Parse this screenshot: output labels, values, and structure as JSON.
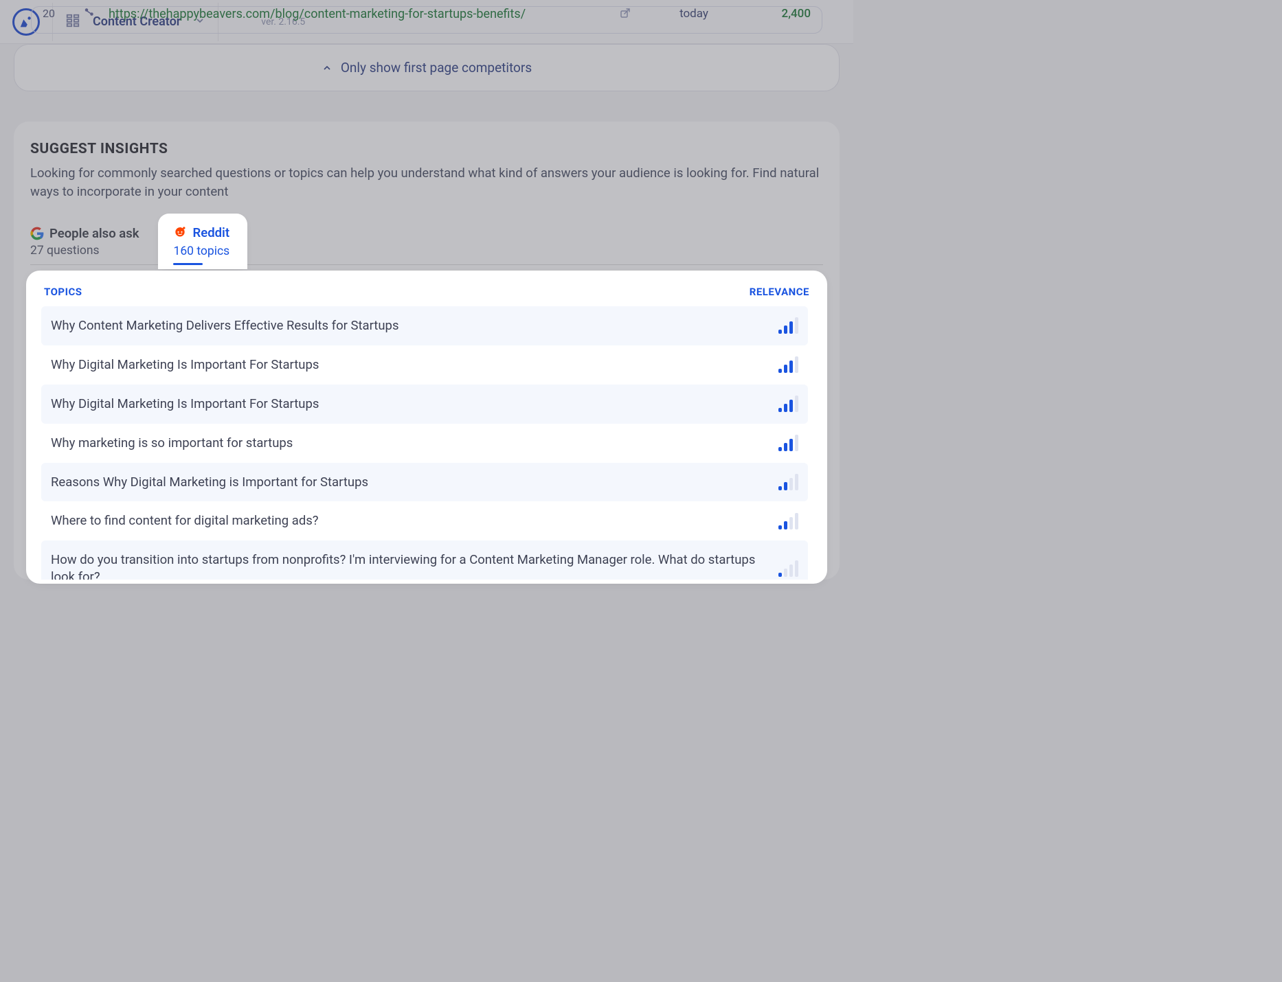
{
  "header": {
    "app_name": "Content Creator",
    "version": "ver. 2.16.5"
  },
  "competitor_row": {
    "rank": "20",
    "url": "https://thehappybeavers.com/blog/content-marketing-for-startups-benefits/",
    "date": "today",
    "words": "2,400"
  },
  "only_first_toggle": "Only show first page competitors",
  "insights": {
    "heading": "SUGGEST INSIGHTS",
    "lead": "Looking for commonly searched questions or topics can help you understand what kind of answers your audience is looking for. Find natural ways to incorporate in your content",
    "tabs": {
      "paa": {
        "title": "People also ask",
        "sub": "27 questions"
      },
      "reddit": {
        "title": "Reddit",
        "sub": "160 topics"
      }
    },
    "columns": {
      "topics": "TOPICS",
      "relevance": "RELEVANCE"
    },
    "topics": [
      {
        "title": "Why Content Marketing Delivers Effective Results for Startups",
        "relevance": 3
      },
      {
        "title": "Why Digital Marketing Is Important For Startups",
        "relevance": 3
      },
      {
        "title": "Why Digital Marketing Is Important For Startups",
        "relevance": 3
      },
      {
        "title": "Why marketing is so important for startups",
        "relevance": 3
      },
      {
        "title": "Reasons Why Digital Marketing is Important for Startups",
        "relevance": 2
      },
      {
        "title": "Where to find content for digital marketing ads?",
        "relevance": 2
      },
      {
        "title": "How do you transition into startups from nonprofits? I'm interviewing for a Content Marketing Manager role. What do startups look for?",
        "relevance": 1
      }
    ]
  }
}
